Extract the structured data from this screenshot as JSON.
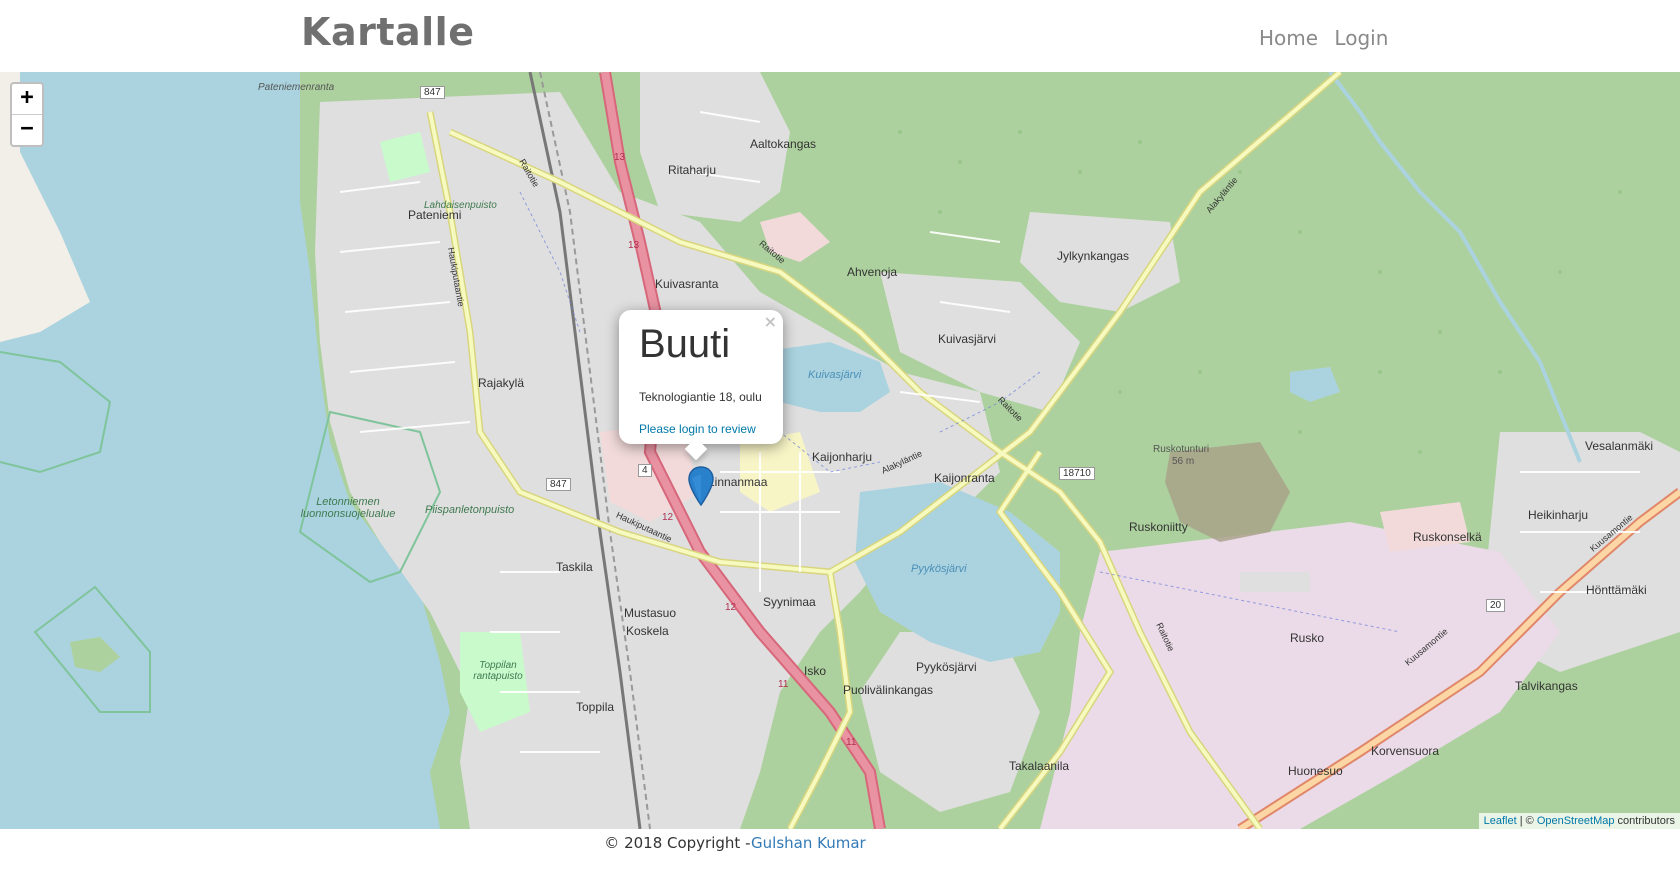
{
  "navbar": {
    "brand": "Kartalle",
    "links": [
      "Home",
      "Login"
    ]
  },
  "map": {
    "zoom_in": "+",
    "zoom_out": "−",
    "place_labels": [
      "Pateniemenranta",
      "Aaltokangas",
      "Ritaharju",
      "Pateniemi",
      "Lahdaisenpuisto",
      "Ahvenoja",
      "Jylkynkangas",
      "Kuivasranta",
      "Kuivasjärvi",
      "Kuivasjärvi",
      "Rajakylä",
      "Kaijonharju",
      "Linnanmaa",
      "Kaijonranta",
      "Ruskotunturi",
      "56 m",
      "Vesalanmäki",
      "Heikinharju",
      "Ruskoniitty",
      "Ruskonselkä",
      "Letonniemen luonnonsuojelualue",
      "Piispanletonpuisto",
      "Taskila",
      "Syynimaa",
      "Pyykösjärvi",
      "Hönttämäki",
      "Mustasuo",
      "Koskela",
      "Rusko",
      "Toppilan rantapuisto",
      "Isko",
      "Pyykösjärvi",
      "Puolivälinkangas",
      "Talvikangas",
      "Toppila",
      "Korvensuora",
      "Takalaanila",
      "Huonesuo"
    ],
    "road_numbers": [
      "847",
      "13",
      "13",
      "4",
      "847",
      "12",
      "12",
      "11",
      "11",
      "18710",
      "20"
    ],
    "road_names": [
      "Raitotie",
      "Raitotie",
      "Alakyläntie",
      "Raitotie",
      "Haukiputaantie",
      "Haukiputaantie",
      "Alakyläntie",
      "Raitotie",
      "Kuusamontie",
      "Kuusamontie"
    ]
  },
  "popup": {
    "close": "×",
    "title": "Buuti",
    "address": "Teknologiantie 18, oulu",
    "review_link": "Please login to review"
  },
  "attribution": {
    "leaflet": "Leaflet",
    "sep": " | © ",
    "osm": "OpenStreetMap",
    "suffix": " contributors"
  },
  "footer": {
    "text": "© 2018 Copyright -",
    "author": "Gulshan Kumar"
  },
  "colors": {
    "water": "#aad3df",
    "forest": "#add19e",
    "residential": "#e0dfdf",
    "industrial": "#ebdbe8",
    "road_major": "#e892a2",
    "road_secondary": "#f7fabf",
    "marker": "#2a81cb"
  }
}
